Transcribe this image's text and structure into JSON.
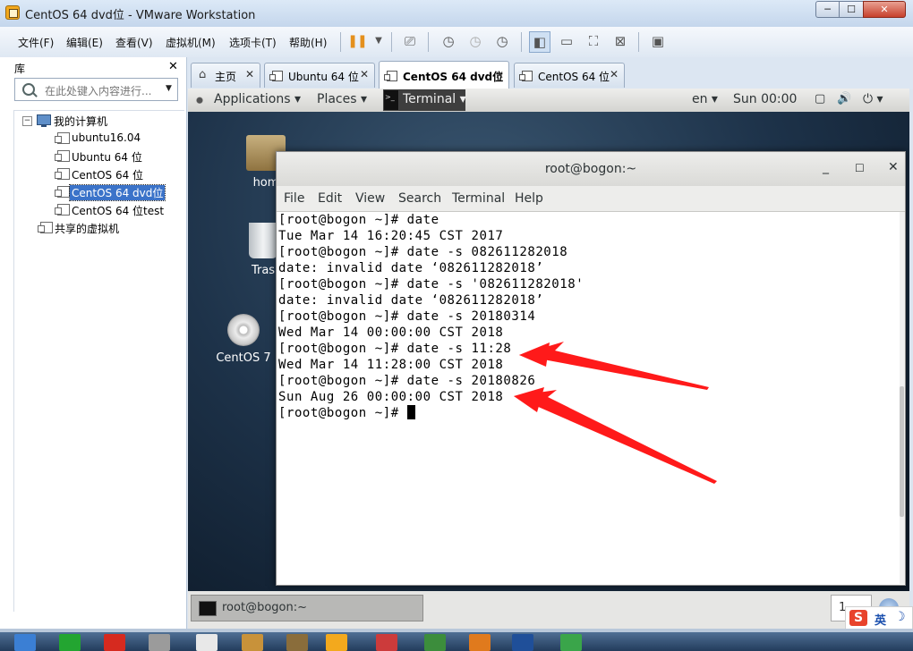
{
  "window": {
    "title": "CentOS 64 dvd位 - VMware Workstation",
    "controls": {
      "minimize": "─",
      "maximize": "☐",
      "close": "✕"
    }
  },
  "menubar": {
    "items": [
      "文件(F)",
      "编辑(E)",
      "查看(V)",
      "虚拟机(M)",
      "选项卡(T)",
      "帮助(H)"
    ]
  },
  "library": {
    "title": "库",
    "close": "✕",
    "search_placeholder": "在此处键入内容进行...",
    "tree": [
      {
        "label": "我的计算机",
        "level": 0,
        "expander": "−"
      },
      {
        "label": "ubuntu16.04",
        "level": 1
      },
      {
        "label": "Ubuntu 64 位",
        "level": 1
      },
      {
        "label": "CentOS 64 位",
        "level": 1
      },
      {
        "label": "CentOS 64 dvd位",
        "level": 1,
        "selected": true
      },
      {
        "label": "CentOS 64 位test",
        "level": 1
      },
      {
        "label": "共享的虚拟机",
        "level": 0
      }
    ]
  },
  "tabs": [
    {
      "label": "主页",
      "icon": "home-icon"
    },
    {
      "label": "Ubuntu 64 位",
      "icon": "vm-icon"
    },
    {
      "label": "CentOS 64 dvd位",
      "icon": "vm-icon",
      "active": true
    },
    {
      "label": "CentOS 64 位",
      "icon": "vm-icon"
    }
  ],
  "tab_close": "✕",
  "gnome_topbar": {
    "applications": "Applications ▾",
    "places": "Places ▾",
    "terminal": "Terminal ▾",
    "lang": "en ▾",
    "clock": "Sun 00:00",
    "power": "⏻ ▾",
    "volume": "🔊"
  },
  "desktop_icons": [
    {
      "label": "hom",
      "icon": "home-folder-icon"
    },
    {
      "label": "Tras",
      "icon": "trash-icon"
    },
    {
      "label": "CentOS 7",
      "icon": "disc-icon"
    }
  ],
  "terminal": {
    "title": "root@bogon:~",
    "controls": {
      "minimize": "_",
      "maximize": "☐",
      "close": "✕"
    },
    "menu": [
      "File",
      "Edit",
      "View",
      "Search",
      "Terminal",
      "Help"
    ],
    "lines": [
      "[root@bogon ~]# date",
      "Tue Mar 14 16:20:45 CST 2017",
      "[root@bogon ~]# date -s 082611282018",
      "date: invalid date ‘082611282018’",
      "[root@bogon ~]# date -s '082611282018'",
      "date: invalid date ‘082611282018’",
      "[root@bogon ~]# date -s 20180314",
      "Wed Mar 14 00:00:00 CST 2018",
      "[root@bogon ~]# date -s 11:28",
      "Wed Mar 14 11:28:00 CST 2018",
      "[root@bogon ~]# date -s 20180826",
      "Sun Aug 26 00:00:00 CST 2018"
    ],
    "prompt": "[root@bogon ~]# "
  },
  "guest_taskbar": {
    "window_label": "root@bogon:~",
    "pager": "1"
  },
  "ime": {
    "logo": "S",
    "lang": "英",
    "mode": "☽"
  },
  "colors": {
    "accent": "#3b73c9",
    "annotation_arrow": "#ff1a1a",
    "close_button": "#c7412c"
  }
}
